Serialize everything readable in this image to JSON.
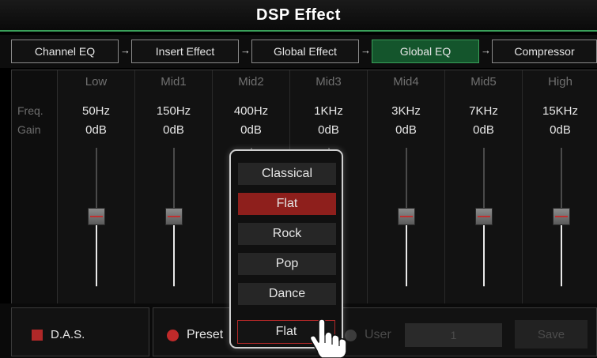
{
  "title": "DSP Effect",
  "nav": {
    "tabs": [
      {
        "label": "Channel EQ",
        "active": false
      },
      {
        "label": "Insert Effect",
        "active": false
      },
      {
        "label": "Global Effect",
        "active": false
      },
      {
        "label": "Global EQ",
        "active": true
      },
      {
        "label": "Compressor",
        "active": false
      }
    ],
    "arrow_glyph": "→"
  },
  "eq": {
    "row_labels": {
      "freq": "Freq.",
      "gain": "Gain"
    },
    "bands": [
      {
        "name": "Low",
        "freq": "50Hz",
        "gain": "0dB"
      },
      {
        "name": "Mid1",
        "freq": "150Hz",
        "gain": "0dB"
      },
      {
        "name": "Mid2",
        "freq": "400Hz",
        "gain": "0dB"
      },
      {
        "name": "Mid3",
        "freq": "1KHz",
        "gain": "0dB"
      },
      {
        "name": "Mid4",
        "freq": "3KHz",
        "gain": "0dB"
      },
      {
        "name": "Mid5",
        "freq": "7KHz",
        "gain": "0dB"
      },
      {
        "name": "High",
        "freq": "15KHz",
        "gain": "0dB"
      }
    ]
  },
  "das": {
    "label": "D.A.S.",
    "checked": true
  },
  "preset": {
    "label": "Preset",
    "selected": true,
    "current_value": "Flat",
    "options": [
      "Classical",
      "Flat",
      "Rock",
      "Pop",
      "Dance"
    ],
    "highlighted_option": "Flat"
  },
  "user": {
    "label": "User",
    "number": "1",
    "save_label": "Save",
    "enabled": false
  },
  "colors": {
    "accent_green": "#14552c",
    "accent_red": "#b02828",
    "background": "#000000"
  },
  "icons": {
    "pointer": "hand-pointer-icon"
  }
}
